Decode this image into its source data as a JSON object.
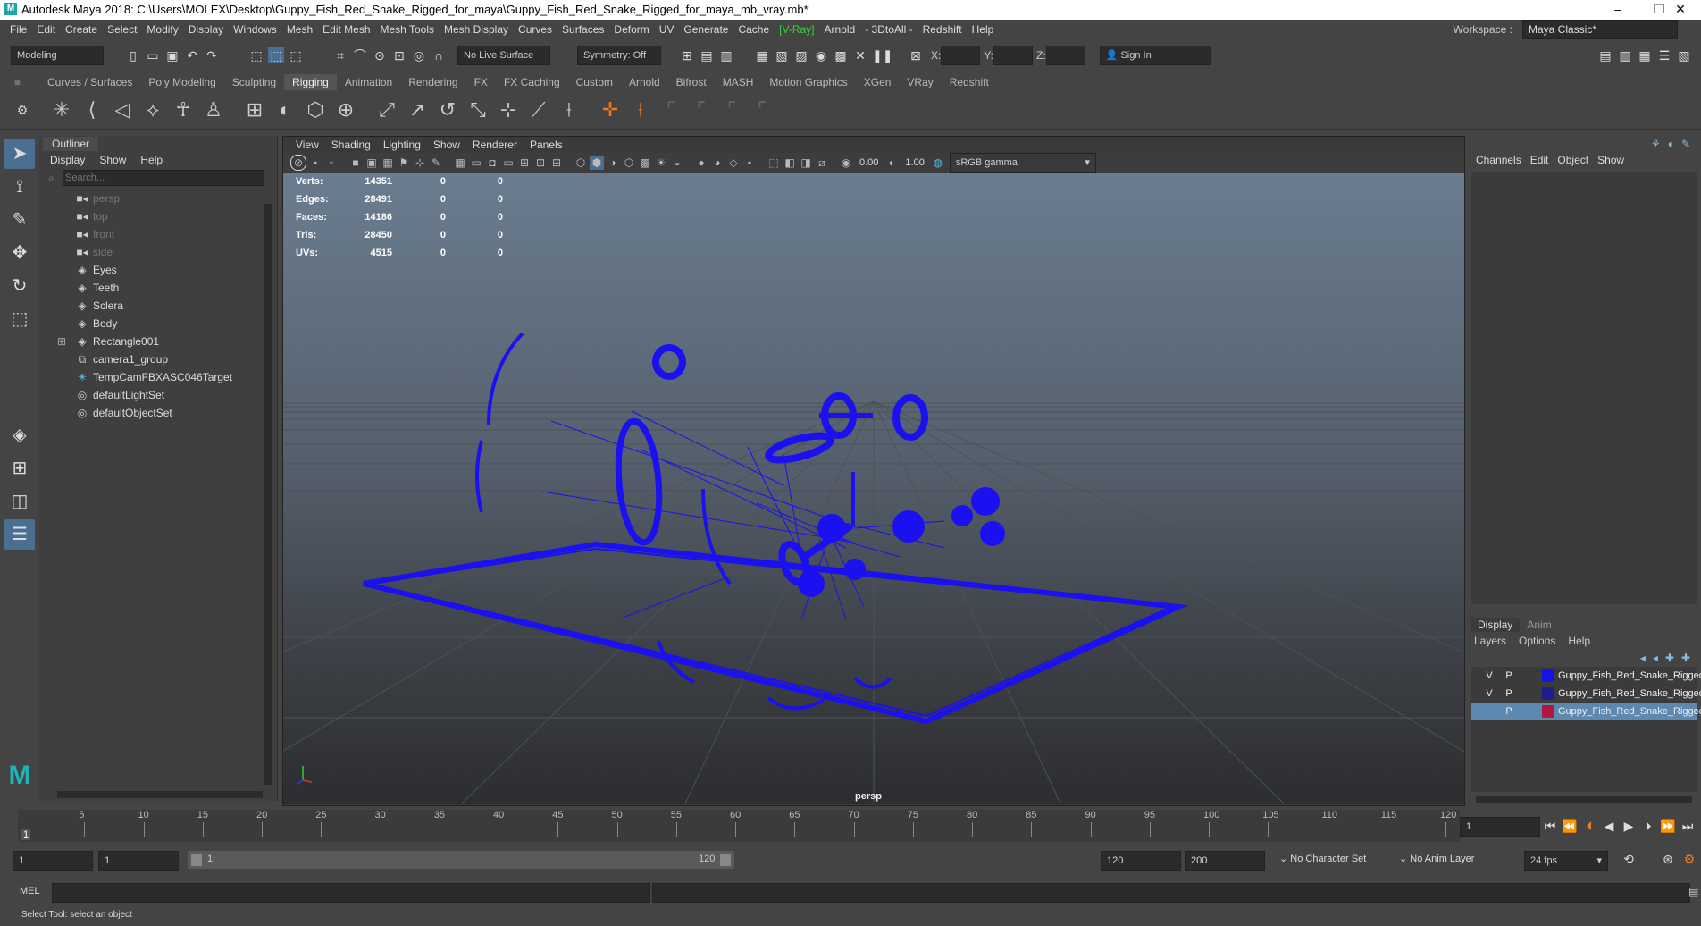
{
  "window": {
    "title": "Autodesk Maya 2018: C:\\Users\\MOLEX\\Desktop\\Guppy_Fish_Red_Snake_Rigged_for_maya\\Guppy_Fish_Red_Snake_Rigged_for_maya_mb_vray.mb*",
    "logo_letter": "M"
  },
  "menubar": {
    "items": [
      "File",
      "Edit",
      "Create",
      "Select",
      "Modify",
      "Display",
      "Windows",
      "Mesh",
      "Edit Mesh",
      "Mesh Tools",
      "Mesh Display",
      "Curves",
      "Surfaces",
      "Deform",
      "UV",
      "Generate",
      "Cache",
      "[V-Ray]",
      "Arnold",
      "3DtoAll",
      "Redshift",
      "Help"
    ],
    "workspace_label": "Workspace :",
    "workspace_value": "Maya Classic*"
  },
  "statusline": {
    "mode": "Modeling",
    "live_surface": "No Live Surface",
    "symmetry": "Symmetry: Off",
    "x_label": "X:",
    "y_label": "Y:",
    "z_label": "Z:",
    "sign_in": "Sign In"
  },
  "shelf": {
    "tabs": [
      "Curves / Surfaces",
      "Poly Modeling",
      "Sculpting",
      "Rigging",
      "Animation",
      "Rendering",
      "FX",
      "FX Caching",
      "Custom",
      "Arnold",
      "Bifrost",
      "MASH",
      "Motion Graphics",
      "XGen",
      "VRay",
      "Redshift"
    ],
    "active_tab": "Rigging"
  },
  "outliner": {
    "title": "Outliner",
    "menu": [
      "Display",
      "Show",
      "Help"
    ],
    "search_placeholder": "Search...",
    "items": [
      {
        "label": "persp",
        "icon": "camera-icon",
        "dim": true
      },
      {
        "label": "top",
        "icon": "camera-icon",
        "dim": true
      },
      {
        "label": "front",
        "icon": "camera-icon",
        "dim": true
      },
      {
        "label": "side",
        "icon": "camera-icon",
        "dim": true
      },
      {
        "label": "Eyes",
        "icon": "mesh-icon",
        "dim": false
      },
      {
        "label": "Teeth",
        "icon": "mesh-icon",
        "dim": false
      },
      {
        "label": "Sclera",
        "icon": "mesh-icon",
        "dim": false
      },
      {
        "label": "Body",
        "icon": "mesh-icon",
        "dim": false
      },
      {
        "label": "Rectangle001",
        "icon": "mesh-icon",
        "dim": false,
        "expand": "⊞"
      },
      {
        "label": "camera1_group",
        "icon": "group-icon",
        "dim": false
      },
      {
        "label": "TempCamFBXASC046Target",
        "icon": "locator-icon",
        "dim": false
      },
      {
        "label": "defaultLightSet",
        "icon": "set-icon",
        "dim": false
      },
      {
        "label": "defaultObjectSet",
        "icon": "set-icon",
        "dim": false
      }
    ]
  },
  "viewport": {
    "menu": [
      "View",
      "Shading",
      "Lighting",
      "Show",
      "Renderer",
      "Panels"
    ],
    "field_near": "0.00",
    "field_far": "1.00",
    "color_space": "sRGB gamma",
    "camera_label": "persp",
    "hud": [
      {
        "label": "Verts:",
        "a": "14351",
        "b": "0",
        "c": "0"
      },
      {
        "label": "Edges:",
        "a": "28491",
        "b": "0",
        "c": "0"
      },
      {
        "label": "Faces:",
        "a": "14186",
        "b": "0",
        "c": "0"
      },
      {
        "label": "Tris:",
        "a": "28450",
        "b": "0",
        "c": "0"
      },
      {
        "label": "UVs:",
        "a": "4515",
        "b": "0",
        "c": "0"
      }
    ],
    "rig_color": "#1a10f0"
  },
  "channelbox": {
    "menu": [
      "Channels",
      "Edit",
      "Object",
      "Show"
    ],
    "layer_tabs": [
      "Display",
      "Anim"
    ],
    "layer_menu": [
      "Layers",
      "Options",
      "Help"
    ],
    "layers": [
      {
        "v": "V",
        "p": "P",
        "color": "#1414e6",
        "name": "Guppy_Fish_Red_Snake_Rigged",
        "selected": false
      },
      {
        "v": "V",
        "p": "P",
        "color": "#1e1e8c",
        "name": "Guppy_Fish_Red_Snake_Rigged",
        "selected": false
      },
      {
        "v": "",
        "p": "P",
        "color": "#b0183c",
        "name": "Guppy_Fish_Red_Snake_Rigged",
        "selected": true
      }
    ]
  },
  "timeslider": {
    "ticks": [
      "5",
      "10",
      "15",
      "20",
      "25",
      "30",
      "35",
      "40",
      "45",
      "50",
      "55",
      "60",
      "65",
      "70",
      "75",
      "80",
      "85",
      "90",
      "95",
      "100",
      "105",
      "110",
      "115",
      "120"
    ],
    "current_frame": "1",
    "current_field": "1"
  },
  "rangeslider": {
    "start": "1",
    "start_inner": "1",
    "range_start": "1",
    "range_end": "120",
    "end_inner": "120",
    "end": "200",
    "character_set": "No Character Set",
    "anim_layer": "No Anim Layer",
    "fps": "24 fps"
  },
  "commandline": {
    "lang": "MEL",
    "help_text": "Select Tool: select an object"
  }
}
